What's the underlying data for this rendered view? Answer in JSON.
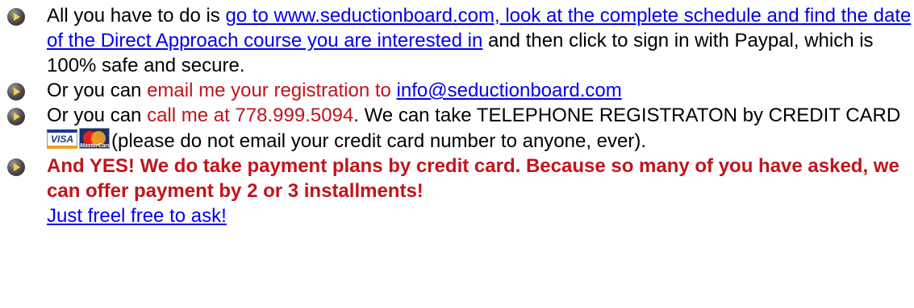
{
  "items": [
    {
      "icon": "bullet-arrow-icon",
      "text1": "All you have to do is ",
      "link": " go to www.seductionboard.com, look at the complete schedule and find the date of the Direct Approach course you are interested in",
      "text2": " and then click to sign in with Paypal, which is 100% safe and secure."
    },
    {
      "icon": "bullet-arrow-icon",
      "text1": "Or you can ",
      "red": "email me your registration to",
      "space": " ",
      "link": "info@seductionboard.com"
    },
    {
      "icon": "bullet-arrow-icon",
      "text1": "Or you can ",
      "red": "call me at 778.999.5094",
      "text2": ". We can take TELEPHONE REGISTRATON by CREDIT CARD ",
      "visa": "VISA",
      "mastercard": "MasterCard",
      "text3": "(please do not email your credit card number to anyone, ever)."
    },
    {
      "icon": "bullet-arrow-icon",
      "bold": "And YES! We do take payment plans by credit card. Because so many of you have asked, we can offer payment by 2 or 3 installments!",
      "link": "Just freel free to ask!"
    }
  ],
  "colors": {
    "link": "#0000ee",
    "accent_red": "#c0141c",
    "text": "#000000"
  }
}
